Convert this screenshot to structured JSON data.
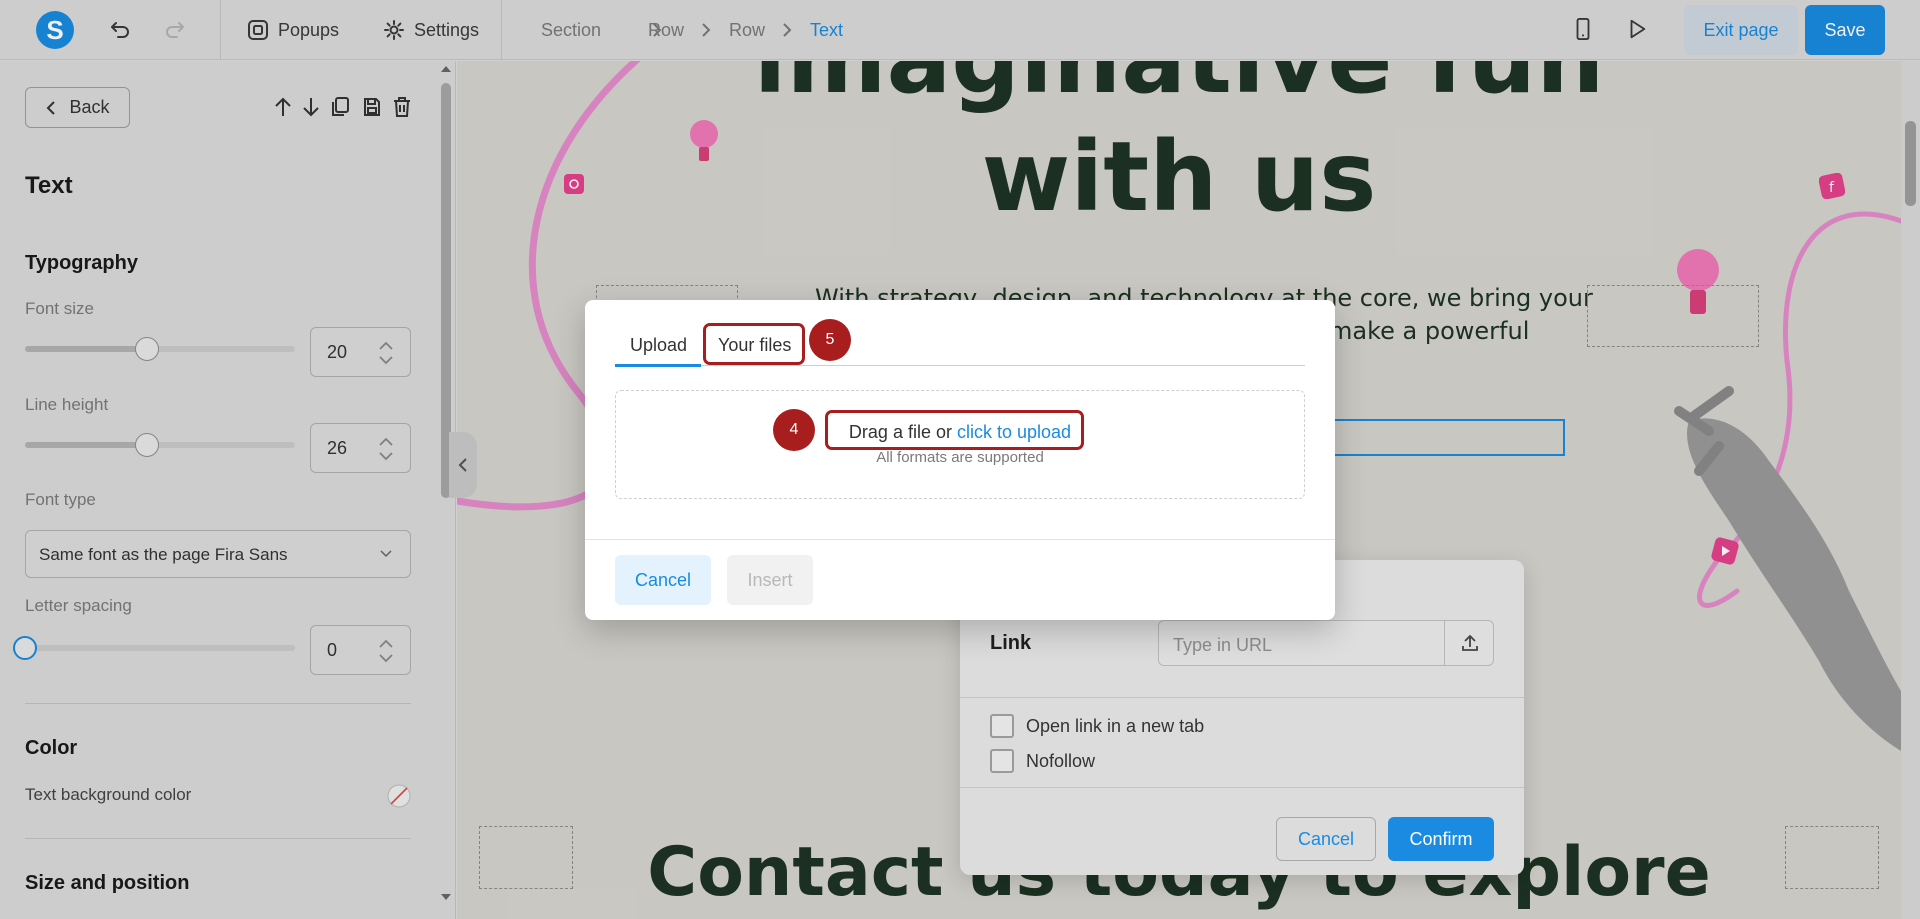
{
  "topbar": {
    "logo": "S",
    "popups_label": "Popups",
    "settings_label": "Settings",
    "breadcrumb": [
      "Section",
      "Row",
      "Row",
      "Text"
    ],
    "exit_label": "Exit page",
    "save_label": "Save"
  },
  "sidebar": {
    "back_label": "Back",
    "title": "Text",
    "typography_heading": "Typography",
    "font_size_label": "Font size",
    "font_size_value": "20",
    "font_size_level": 0.45,
    "line_height_label": "Line height",
    "line_height_value": "26",
    "line_height_level": 0.45,
    "font_type_label": "Font type",
    "font_type_value": "Same font as the page Fira Sans",
    "letter_spacing_label": "Letter spacing",
    "letter_spacing_value": "0",
    "letter_spacing_level": 0,
    "color_heading": "Color",
    "text_bg_color_label": "Text background color",
    "size_position_heading": "Size and position"
  },
  "canvas": {
    "headline_top": "imaginative fun",
    "headline_main": "with us",
    "body_line1": "With strategy, design, and technology at the core, we bring your",
    "body_line2": "make a powerful",
    "bottom_headline": "Contact us today to explore",
    "colors": {
      "headline": "#1d3324",
      "accent_pink": "#e55fa6"
    }
  },
  "upload_modal": {
    "tabs": [
      "Upload",
      "Your files"
    ],
    "active_tab": "Upload",
    "drop_text": "Drag a file or",
    "drop_link": "click to upload",
    "formats_text": "All formats are supported",
    "cancel_label": "Cancel",
    "insert_label": "Insert",
    "badge_4": "4",
    "badge_5": "5"
  },
  "link_panel": {
    "link_label": "Link",
    "url_placeholder": "Type in URL",
    "new_tab_label": "Open link in a new tab",
    "nofollow_label": "Nofollow",
    "cancel_label": "Cancel",
    "confirm_label": "Confirm"
  },
  "colors": {
    "accent": "#1a8be0",
    "highlight": "#a81d1d"
  }
}
